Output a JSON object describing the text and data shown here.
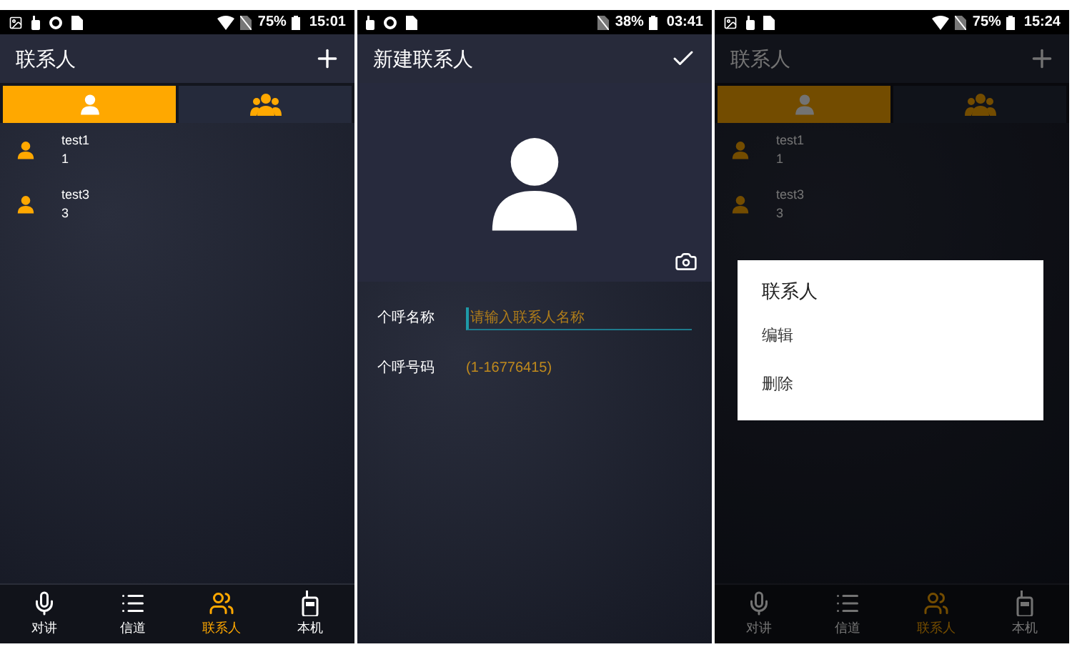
{
  "screens": [
    {
      "kind": "list",
      "status_bar": {
        "notifications": [
          {
            "kind": "image"
          },
          {
            "kind": "radio"
          },
          {
            "kind": "circle"
          },
          {
            "kind": "sim"
          }
        ],
        "wifi": true,
        "battery": "75%",
        "time": "15:01"
      },
      "header": {
        "title": "联系人"
      },
      "tabs": [
        {
          "kind": "person",
          "selected": true
        },
        {
          "kind": "group",
          "selected": false
        }
      ],
      "contacts": [
        {
          "name": "test1",
          "number": "1"
        },
        {
          "name": "test3",
          "number": "3"
        }
      ],
      "nav": [
        {
          "kind": "mic",
          "label": "对讲",
          "selected": false
        },
        {
          "kind": "list",
          "label": "信道",
          "selected": false
        },
        {
          "kind": "contacts",
          "label": "联系人",
          "selected": true
        },
        {
          "kind": "device",
          "label": "本机",
          "selected": false
        }
      ]
    },
    {
      "kind": "form",
      "status_bar": {
        "notifications": [
          {
            "kind": "radio"
          },
          {
            "kind": "circle"
          },
          {
            "kind": "sim"
          }
        ],
        "wifi": false,
        "battery": "38%",
        "time": "03:41"
      },
      "header": {
        "title": "新建联系人"
      },
      "fields": [
        {
          "label": "个呼名称",
          "placeholder": "请输入联系人名称"
        },
        {
          "label": "个呼号码",
          "value": "(1-16776415)"
        }
      ]
    },
    {
      "kind": "list",
      "status_bar": {
        "notifications": [
          {
            "kind": "image"
          },
          {
            "kind": "radio"
          },
          {
            "kind": "sim"
          }
        ],
        "wifi": true,
        "battery": "75%",
        "time": "15:24"
      },
      "header": {
        "title": "联系人"
      },
      "tabs": [
        {
          "kind": "person",
          "selected": true
        },
        {
          "kind": "group",
          "selected": false
        }
      ],
      "contacts": [
        {
          "name": "test1",
          "number": "1"
        },
        {
          "name": "test3",
          "number": "3"
        }
      ],
      "nav": [
        {
          "kind": "mic",
          "label": "对讲",
          "selected": false
        },
        {
          "kind": "list",
          "label": "信道",
          "selected": false
        },
        {
          "kind": "contacts",
          "label": "联系人",
          "selected": true
        },
        {
          "kind": "device",
          "label": "本机",
          "selected": false
        }
      ],
      "dialog": {
        "title": "联系人",
        "items": [
          "编辑",
          "删除"
        ]
      }
    }
  ]
}
